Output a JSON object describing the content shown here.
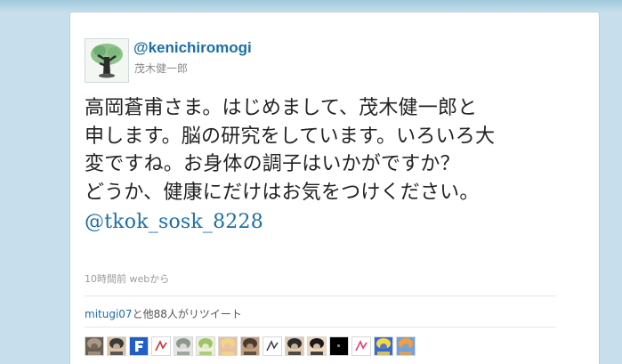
{
  "tweet": {
    "screen_name": "@kenichiromogi",
    "real_name": "茂木健一郎",
    "text_lines": [
      "高岡蒼甫さま。はじめまして、茂木健一郎と",
      "申します。脳の研究をしています。いろいろ大",
      "変ですね。お身体の調子はいかがですか？",
      "どうか、健康にだけはお気をつけください。"
    ],
    "mention": "@tkok_sosk_8228",
    "timestamp": "10時間前",
    "source": "webから"
  },
  "retweets": {
    "first_user": "mitugi07",
    "suffix": "と他88人がリツイート",
    "avatars": [
      {
        "icon": "avatar-photo",
        "colors": [
          "#a89a86",
          "#6b5f52"
        ]
      },
      {
        "icon": "avatar-anime-dark-hair",
        "colors": [
          "#3a3a3a",
          "#d8c2a8"
        ]
      },
      {
        "icon": "avatar-blue-letter-f",
        "colors": [
          "#1f5fc7",
          "#ffffff"
        ]
      },
      {
        "icon": "avatar-red-sketch",
        "colors": [
          "#ffffff",
          "#d03030"
        ]
      },
      {
        "icon": "avatar-grey-creature",
        "colors": [
          "#8a9a8a",
          "#e6e6e6"
        ]
      },
      {
        "icon": "avatar-green-cartoon",
        "colors": [
          "#9cc46a",
          "#f0f0d8"
        ]
      },
      {
        "icon": "avatar-blonde-girl",
        "colors": [
          "#f2d58a",
          "#e8c0a0"
        ]
      },
      {
        "icon": "avatar-dark-figure",
        "colors": [
          "#4a3b2e",
          "#c0a080"
        ]
      },
      {
        "icon": "avatar-sketch-lines",
        "colors": [
          "#ffffff",
          "#444444"
        ]
      },
      {
        "icon": "avatar-face-photo",
        "colors": [
          "#2b2b2b",
          "#e0c8b0"
        ]
      },
      {
        "icon": "avatar-anime-black-hair",
        "colors": [
          "#1a1a1a",
          "#f0d8c0"
        ]
      },
      {
        "icon": "avatar-black-square",
        "colors": [
          "#000000",
          "#333333"
        ]
      },
      {
        "icon": "avatar-pink-text",
        "colors": [
          "#ffffff",
          "#e04070"
        ]
      },
      {
        "icon": "avatar-yellow-character",
        "colors": [
          "#f5d84a",
          "#3a6ad0"
        ]
      },
      {
        "icon": "avatar-colorful-anime",
        "colors": [
          "#f0a040",
          "#70a0e0"
        ]
      }
    ]
  }
}
